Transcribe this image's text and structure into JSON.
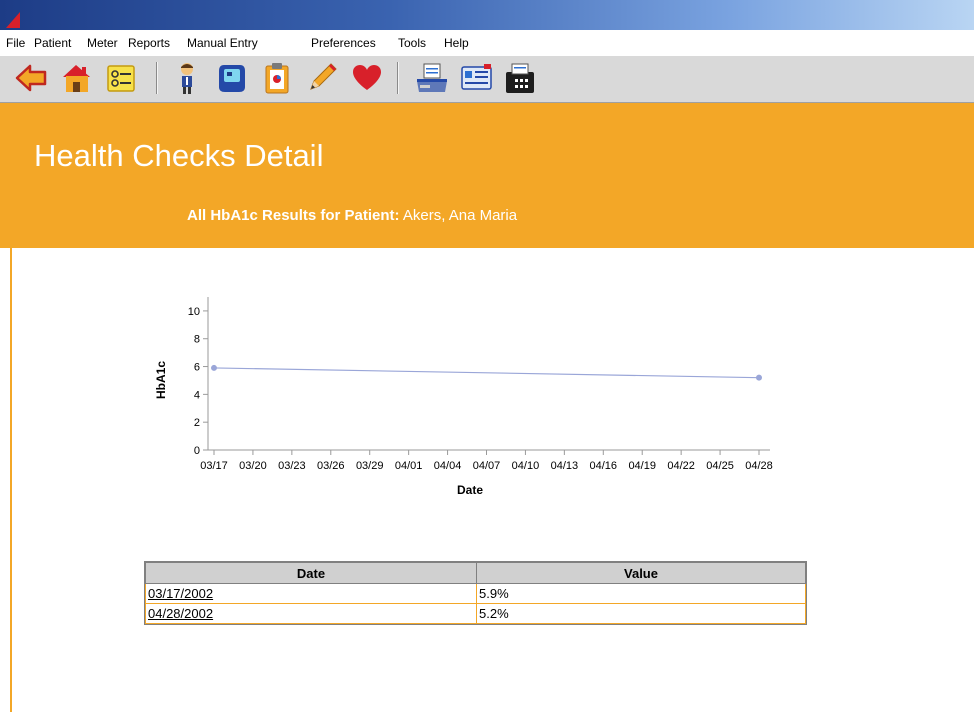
{
  "menu": [
    "File",
    "Patient",
    "Meter",
    "Reports",
    "Manual Entry",
    "Preferences",
    "Tools",
    "Help"
  ],
  "toolbar": {
    "icons": [
      "back-arrow-icon",
      "home-icon",
      "checklist-icon",
      "patient-icon",
      "meter-icon",
      "clipboard-icon",
      "pencil-icon",
      "heart-icon",
      "printer-icon",
      "card-icon",
      "fax-icon"
    ]
  },
  "header": {
    "title": "Health Checks Detail",
    "subtitle_label": "All HbA1c Results for Patient:",
    "patient_name": "Akers, Ana Maria"
  },
  "chart_data": {
    "type": "line",
    "xlabel": "Date",
    "ylabel": "HbA1c",
    "x": [
      "03/17",
      "04/28"
    ],
    "x_day_index": [
      0,
      42
    ],
    "series": [
      {
        "values": [
          5.9,
          5.2
        ],
        "color": "#9aa6d8"
      }
    ],
    "xticks": [
      "03/17",
      "03/20",
      "03/23",
      "03/26",
      "03/29",
      "04/01",
      "04/04",
      "04/07",
      "04/10",
      "04/13",
      "04/16",
      "04/19",
      "04/22",
      "04/25",
      "04/28"
    ],
    "yticks": [
      0,
      2,
      4,
      6,
      8,
      10
    ],
    "ylim": [
      0,
      11
    ],
    "grid": false
  },
  "table": {
    "headers": [
      "Date",
      "Value"
    ],
    "rows": [
      {
        "date": "03/17/2002",
        "value": "5.9%"
      },
      {
        "date": "04/28/2002",
        "value": "5.2%"
      }
    ]
  },
  "colors": {
    "accent": "#f3a727",
    "series_line": "#9aa6d8"
  }
}
